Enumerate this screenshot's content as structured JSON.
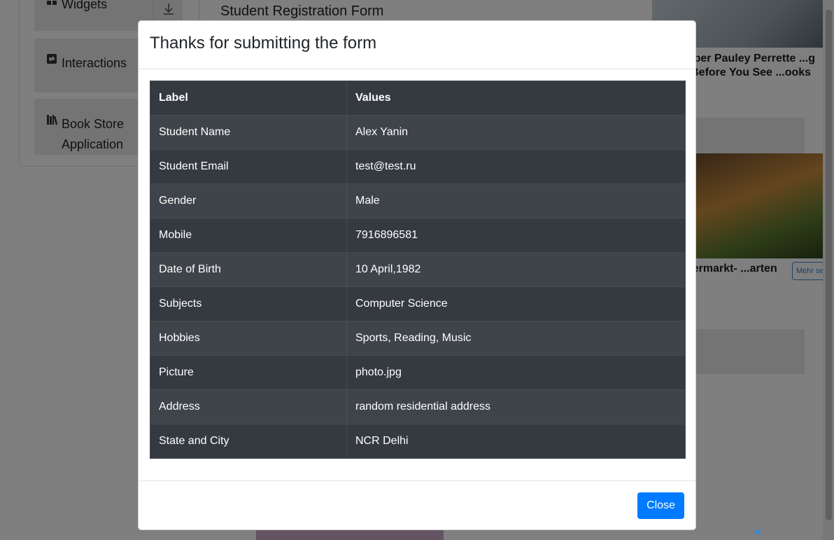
{
  "sidebar": {
    "groups": [
      {
        "label": "Widgets",
        "icon": "widgets-icon"
      },
      {
        "label": "Interactions",
        "icon": "interactions-icon"
      },
      {
        "label": "Book Store Application",
        "icon": "book-icon"
      }
    ]
  },
  "page": {
    "title": "Student Registration Form"
  },
  "ads": {
    "headline1": "...emember Pauley Perrette ...g Breath Before You See ...ooks Like.",
    "headline2": "...n Supermarkt- ...arten",
    "more_label": "Mehr se..."
  },
  "modal": {
    "title": "Thanks for submitting the form",
    "table": {
      "headers": [
        "Label",
        "Values"
      ],
      "rows": [
        [
          "Student Name",
          "Alex Yanin"
        ],
        [
          "Student Email",
          "test@test.ru"
        ],
        [
          "Gender",
          "Male"
        ],
        [
          "Mobile",
          "7916896581"
        ],
        [
          "Date of Birth",
          "10 April,1982"
        ],
        [
          "Subjects",
          "Computer Science"
        ],
        [
          "Hobbies",
          "Sports, Reading, Music"
        ],
        [
          "Picture",
          "photo.jpg"
        ],
        [
          "Address",
          "random residential address"
        ],
        [
          "State and City",
          "NCR Delhi"
        ]
      ]
    },
    "close_label": "Close"
  },
  "colors": {
    "primary": "#007bff",
    "table_dark": "#343a40",
    "backdrop": "rgba(0,0,0,0.5)"
  }
}
